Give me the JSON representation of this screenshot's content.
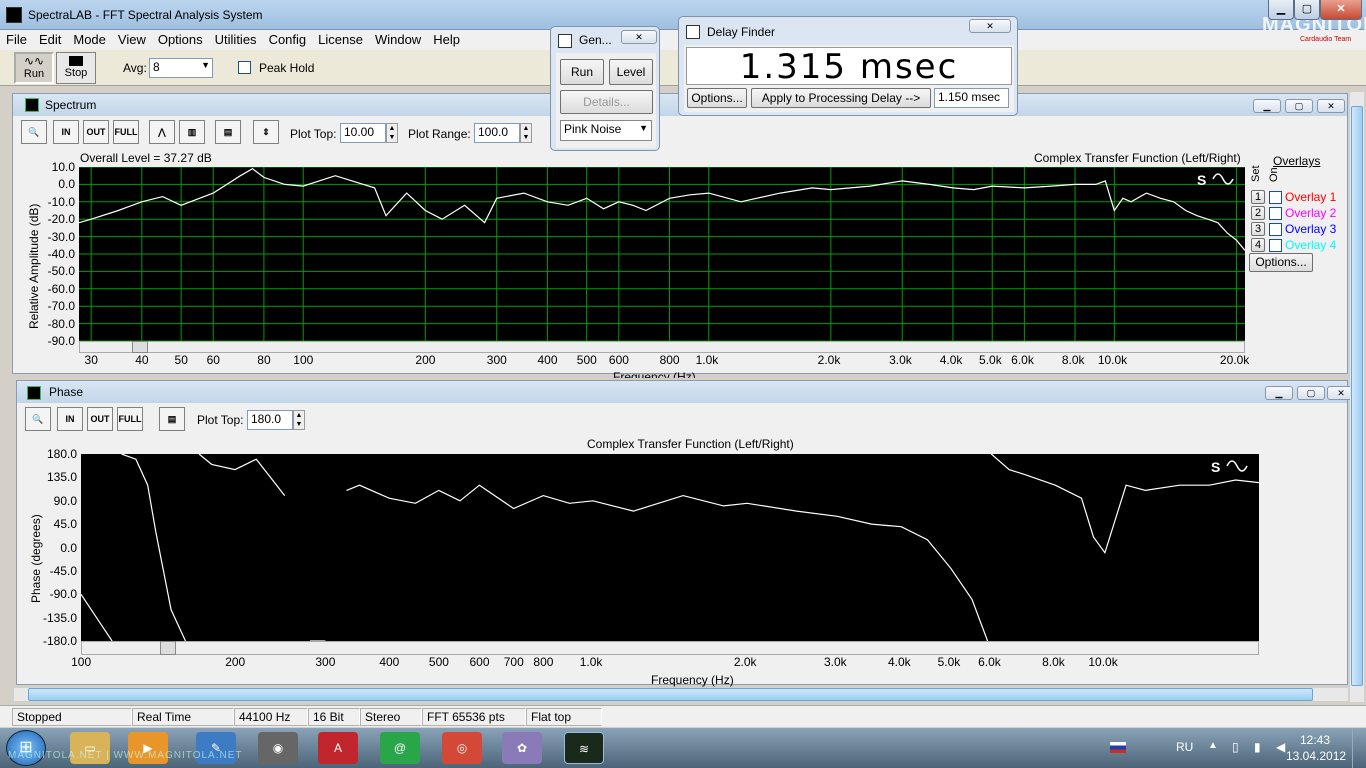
{
  "app": {
    "title": "SpectraLAB - FFT Spectral Analysis System",
    "watermark": "MAGNITOLA",
    "watermark_sub": "Cardaudio Team"
  },
  "menu": [
    "File",
    "Edit",
    "Mode",
    "View",
    "Options",
    "Utilities",
    "Config",
    "License",
    "Window",
    "Help"
  ],
  "toolbar": {
    "run": "Run",
    "stop": "Stop",
    "avg_label": "Avg:",
    "avg_value": "8",
    "peak_hold": "Peak Hold"
  },
  "spectrum": {
    "title": "Spectrum",
    "plot_top_label": "Plot Top:",
    "plot_top": "10.00",
    "plot_range_label": "Plot Range:",
    "plot_range": "100.0",
    "overall": "Overall Level = 37.27 dB",
    "chart_title": "Complex Transfer Function (Left/Right)",
    "ylabel": "Relative Amplitude (dB)",
    "xlabel": "Frequency (Hz)",
    "yticks": [
      "10.0",
      "0.0",
      "-10.0",
      "-20.0",
      "-30.0",
      "-40.0",
      "-50.0",
      "-60.0",
      "-70.0",
      "-80.0",
      "-90.0"
    ],
    "xticks": [
      "30",
      "40",
      "50",
      "60",
      "80",
      "100",
      "200",
      "300",
      "400",
      "500",
      "600",
      "800",
      "1.0k",
      "2.0k",
      "3.0k",
      "4.0k",
      "5.0k",
      "6.0k",
      "8.0k",
      "10.0k",
      "20.0k"
    ],
    "overlays": {
      "title": "Overlays",
      "set": "Set",
      "on": "On",
      "items": [
        {
          "num": "1",
          "label": "Overlay 1",
          "color": "#ff0000"
        },
        {
          "num": "2",
          "label": "Overlay 2",
          "color": "#ff00ff"
        },
        {
          "num": "3",
          "label": "Overlay 3",
          "color": "#0000ff"
        },
        {
          "num": "4",
          "label": "Overlay 4",
          "color": "#00ffff"
        }
      ],
      "options": "Options..."
    }
  },
  "phase": {
    "title": "Phase",
    "plot_top_label": "Plot Top:",
    "plot_top": "180.0",
    "chart_title": "Complex Transfer Function (Left/Right)",
    "ylabel": "Phase (degrees)",
    "xlabel": "Frequency (Hz)",
    "yticks": [
      "180.0",
      "135.0",
      "90.0",
      "45.0",
      "0.0",
      "-45.0",
      "-90.0",
      "-135.0",
      "-180.0"
    ],
    "xticks": [
      "100",
      "200",
      "300",
      "400",
      "500",
      "600",
      "700",
      "800",
      "1.0k",
      "2.0k",
      "3.0k",
      "4.0k",
      "5.0k",
      "6.0k",
      "8.0k",
      "10.0k"
    ]
  },
  "generator": {
    "title": "Gen...",
    "run": "Run",
    "level": "Level",
    "details": "Details...",
    "signal": "Pink Noise"
  },
  "delay": {
    "title": "Delay Finder",
    "value": "1.315 msec",
    "options": "Options...",
    "apply": "Apply to Processing Delay -->",
    "current": "1.150 msec"
  },
  "status": [
    "Stopped",
    "Real Time",
    "44100 Hz",
    "16 Bit",
    "Stereo",
    "FFT 65536 pts",
    "Flat top"
  ],
  "taskbar": {
    "lang": "RU",
    "time": "12:43",
    "date": "13.04.2012",
    "tooltip": "MAGNITOLA.NET | WWW.MAGNITOLA.NET"
  },
  "chart_data": [
    {
      "type": "line",
      "title": "Complex Transfer Function (Left/Right)",
      "ylabel": "Relative Amplitude (dB)",
      "xlabel": "Frequency (Hz)",
      "x_scale": "log",
      "xlim": [
        28,
        21000
      ],
      "ylim": [
        -90,
        10
      ],
      "grid": true,
      "series": [
        {
          "color": "#ffffff",
          "x": [
            28,
            30,
            35,
            40,
            45,
            50,
            60,
            70,
            75,
            80,
            90,
            100,
            120,
            150,
            160,
            180,
            200,
            220,
            250,
            280,
            300,
            350,
            400,
            450,
            500,
            550,
            600,
            650,
            700,
            800,
            900,
            1000,
            1200,
            1500,
            1800,
            2000,
            2500,
            3000,
            3500,
            4000,
            4500,
            5000,
            6000,
            7000,
            8000,
            9000,
            9500,
            10000,
            10500,
            11000,
            12000,
            13000,
            14000,
            15000,
            16000,
            17000,
            18000,
            19000,
            20000,
            21000
          ],
          "y": [
            -22,
            -20,
            -15,
            -10,
            -7,
            -12,
            -5,
            5,
            9,
            4,
            0,
            -1,
            5,
            -2,
            -18,
            -5,
            -15,
            -20,
            -12,
            -22,
            -8,
            -5,
            -10,
            -12,
            -8,
            -14,
            -10,
            -12,
            -15,
            -8,
            -6,
            -5,
            -10,
            -5,
            -2,
            -3,
            -1,
            2,
            0,
            -2,
            -3,
            -1,
            -2,
            -1,
            0,
            0,
            2,
            -15,
            -8,
            -10,
            -5,
            -8,
            -10,
            -15,
            -18,
            -20,
            -22,
            -28,
            -32,
            -38
          ]
        }
      ]
    },
    {
      "type": "line",
      "title": "Complex Transfer Function (Left/Right)",
      "ylabel": "Phase (degrees)",
      "xlabel": "Frequency (Hz)",
      "x_scale": "log",
      "xlim": [
        100,
        20000
      ],
      "ylim": [
        -180,
        180
      ],
      "grid": false,
      "series": [
        {
          "color": "#ffffff",
          "x": [
            100,
            115,
            120,
            128,
            135,
            140,
            150,
            160,
            170,
            180,
            200,
            220,
            250,
            280,
            300,
            330,
            350,
            400,
            450,
            500,
            550,
            600,
            700,
            800,
            900,
            1000,
            1200,
            1500,
            1800,
            2000,
            2500,
            3000,
            3500,
            4000,
            4500,
            5000,
            5500,
            5900,
            6000,
            6500,
            7000,
            8000,
            9000,
            9500,
            10000,
            11000,
            12000,
            14000,
            16000,
            18000,
            20000
          ],
          "y": [
            -90,
            -180,
            180,
            170,
            120,
            30,
            -120,
            -180,
            180,
            160,
            150,
            170,
            100,
            -180,
            -180,
            110,
            120,
            95,
            85,
            110,
            90,
            120,
            75,
            100,
            85,
            90,
            70,
            100,
            80,
            85,
            70,
            60,
            45,
            40,
            15,
            -40,
            -100,
            -180,
            180,
            150,
            140,
            120,
            95,
            20,
            -10,
            120,
            110,
            120,
            120,
            130,
            125
          ]
        }
      ]
    }
  ]
}
